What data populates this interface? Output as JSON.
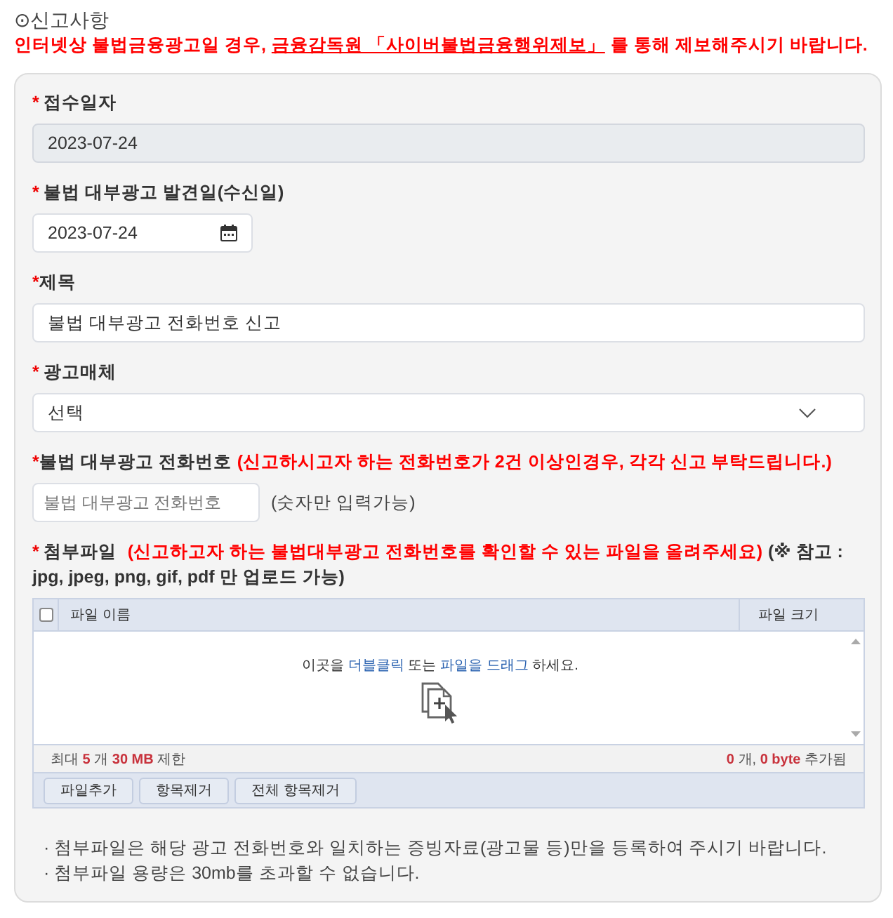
{
  "section": {
    "title": "⊙신고사항"
  },
  "notice": {
    "before": "인터넷상 불법금융광고일 경우,",
    "link": "금융감독원 「사이버불법금융행위제보」",
    "after": "를 통해 제보해주시기 바랍니다."
  },
  "fields": [
    {
      "kind": "input",
      "mark": "*",
      "label": "접수일자",
      "value": "2023-07-24",
      "readonly": true
    },
    {
      "kind": "date",
      "mark": "*",
      "label": "불법 대부광고 발견일(수신일)",
      "value": "2023-07-24"
    },
    {
      "kind": "input",
      "mark": "*",
      "label": "제목",
      "value": "불법 대부광고 전화번호 신고",
      "readonly": false
    },
    {
      "kind": "select",
      "mark": "*",
      "label": "광고매체",
      "value": "선택"
    },
    {
      "kind": "phone",
      "mark": "*",
      "label": "불법 대부광고 전화번호",
      "note": "(신고하시고자 하는 전화번호가 2건 이상인경우, 각각 신고 부탁드립니다.)",
      "placeholder": "불법 대부광고 전화번호",
      "hint": "(숫자만 입력가능)"
    },
    {
      "kind": "file",
      "mark": "*",
      "label": "첨부파일",
      "note": "(신고하고자 하는 불법대부광고 전화번호를 확인할 수 있는 파일을 올려주세요)",
      "extra": "(※ 참고 : jpg, jpeg, png, gif, pdf 만 업로드 가능)",
      "uploader": {
        "select_all": {
          "checked": false
        },
        "columns": [
          "파일 이름",
          "파일 크기"
        ],
        "drop_text": [
          {
            "text": "이곳을",
            "highlight": false
          },
          {
            "text": "더블클릭",
            "highlight": true
          },
          {
            "text": "또는",
            "highlight": false
          },
          {
            "text": "파일을 드래그",
            "highlight": true
          },
          {
            "text": "하세요.",
            "highlight": false
          }
        ],
        "limit": [
          {
            "text": "최대",
            "highlight": false
          },
          {
            "text": "5",
            "highlight": true
          },
          {
            "text": "개",
            "highlight": false
          },
          {
            "text": "30 MB",
            "highlight": true
          },
          {
            "text": "제한",
            "highlight": false
          }
        ],
        "total": [
          {
            "text": "0",
            "highlight": true
          },
          {
            "text": "개,",
            "highlight": false
          },
          {
            "text": "0 byte",
            "highlight": true
          },
          {
            "text": "추가됨",
            "highlight": false
          }
        ],
        "buttons": [
          "파일추가",
          "항목제거",
          "전체 항목제거"
        ]
      }
    }
  ],
  "notes": [
    "· 첨부파일은 해당 광고 전화번호와 일치하는 증빙자료(광고물 등)만을 등록하여 주시기 바랍니다.",
    "· 첨부파일 용량은 30mb를 초과할 수 없습니다."
  ]
}
